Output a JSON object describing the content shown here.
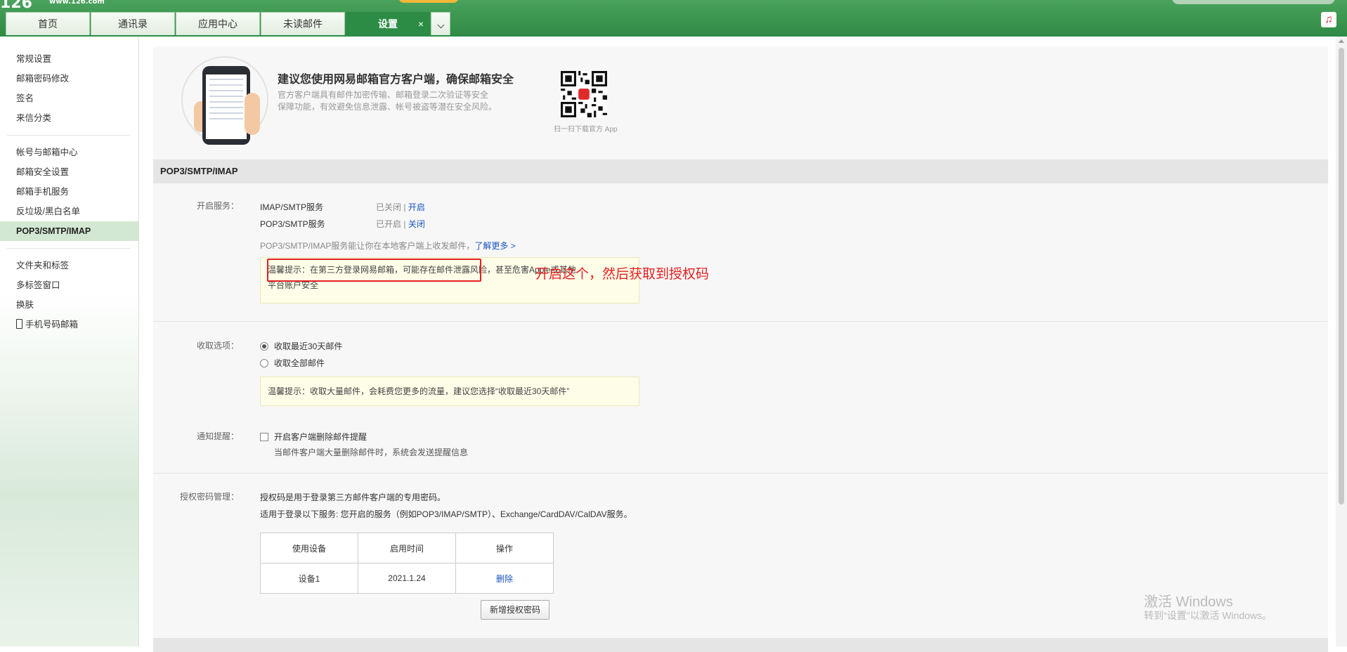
{
  "header": {
    "logo": "126",
    "logo_sub": "www.126.com",
    "tabs": [
      "首页",
      "通讯录",
      "应用中心",
      "未读邮件",
      "设置"
    ],
    "active_tab_close": "×",
    "music_icon": "music-icon"
  },
  "sidebar": {
    "group1": [
      "常规设置",
      "邮箱密码修改",
      "签名",
      "来信分类"
    ],
    "group2": [
      "帐号与邮箱中心",
      "邮箱安全设置",
      "邮箱手机服务",
      "反垃圾/黑白名单",
      "POP3/SMTP/IMAP"
    ],
    "group3": [
      "文件夹和标签",
      "多标签窗口",
      "换肤",
      "手机号码邮箱"
    ],
    "active_item": "POP3/SMTP/IMAP"
  },
  "promo": {
    "title": "建议您使用网易邮箱官方客户端，确保邮箱安全",
    "desc_line1": "官方客户端具有邮件加密传输、邮箱登录二次验证等安全",
    "desc_line2": "保障功能，有效避免信息泄露、帐号被盗等潜在安全风险。",
    "qr_caption": "扫一扫下载官方 App"
  },
  "section": {
    "title": "POP3/SMTP/IMAP",
    "services_label": "开启服务：",
    "imap_name": "IMAP/SMTP服务",
    "imap_status": "已关闭",
    "imap_action": "开启",
    "pop_name": "POP3/SMTP服务",
    "pop_status": "已开启",
    "pop_action": "关闭",
    "separator": "|",
    "desc": "POP3/SMTP/IMAP服务能让你在本地客户端上收发邮件，",
    "learn_more": "了解更多 >",
    "tip1_line1": "温馨提示：在第三方登录网易邮箱，可能存在邮件泄露风险，甚至危害Apple或其他",
    "tip1_line2": "平台账户安全",
    "annotation": "开启这个，然后获取到授权码",
    "receive_label": "收取选项：",
    "receive_opt1": "收取最近30天邮件",
    "receive_opt2": "收取全部邮件",
    "tip2": "温馨提示：收取大量邮件，会耗费您更多的流量，建议您选择“收取最近30天邮件”",
    "notify_label": "通知提醒：",
    "notify_opt": "开启客户端删除邮件提醒",
    "notify_desc": "当邮件客户端大量删除邮件时，系统会发送提醒信息",
    "auth_label": "授权密码管理：",
    "auth_desc1": "授权码是用于登录第三方邮件客户端的专用密码。",
    "auth_desc2": "适用于登录以下服务: 您开启的服务（例如POP3/IMAP/SMTP）、Exchange/CardDAV/CalDAV服务。",
    "table_headers": [
      "使用设备",
      "启用时间",
      "操作"
    ],
    "table_row": [
      "设备1",
      "2021.1.24",
      "删除"
    ],
    "add_button": "新增授权密码"
  },
  "watermark": {
    "line1": "激活 Windows",
    "line2": "转到“设置”以激活 Windows。"
  }
}
